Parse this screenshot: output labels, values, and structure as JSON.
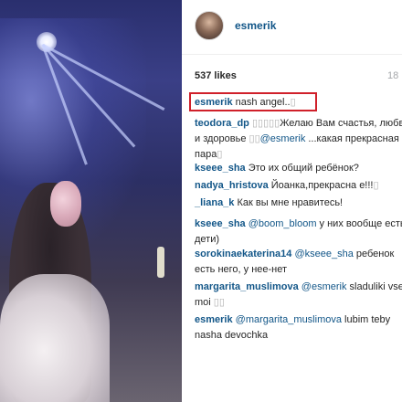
{
  "post": {
    "username": "esmerik",
    "likes": "537 likes",
    "time": "18"
  },
  "comments": [
    {
      "user": "esmerik",
      "parts": [
        {
          "t": "text",
          "v": " nash angel.."
        },
        {
          "t": "emoji",
          "v": "▯"
        }
      ]
    },
    {
      "user": "teodora_dp",
      "parts": [
        {
          "t": "text",
          "v": " "
        },
        {
          "t": "emoji",
          "v": "▯▯▯▯▯"
        },
        {
          "t": "text",
          "v": "Желаю Вам счастья, любви и здоровье "
        },
        {
          "t": "emoji",
          "v": "▯▯"
        },
        {
          "t": "mention",
          "v": "@esmerik"
        },
        {
          "t": "text",
          "v": " ...какая прекрасная пара"
        },
        {
          "t": "emoji",
          "v": "▯"
        }
      ]
    },
    {
      "user": "kseee_sha",
      "parts": [
        {
          "t": "text",
          "v": " Это их общий ребёнок?"
        }
      ]
    },
    {
      "user": "nadya_hristova",
      "parts": [
        {
          "t": "text",
          "v": " Йоанка,прекрасна е!!!"
        },
        {
          "t": "emoji",
          "v": "▯"
        }
      ]
    },
    {
      "user": "_liana_k",
      "parts": [
        {
          "t": "text",
          "v": " Как вы мне нравитесь!"
        }
      ]
    },
    {
      "user": "kseee_sha",
      "parts": [
        {
          "t": "text",
          "v": " "
        },
        {
          "t": "mention",
          "v": "@boom_bloom"
        },
        {
          "t": "text",
          "v": " у них вообще есть дети)"
        }
      ]
    },
    {
      "user": "sorokinaekaterina14",
      "parts": [
        {
          "t": "text",
          "v": " "
        },
        {
          "t": "mention",
          "v": "@kseee_sha"
        },
        {
          "t": "text",
          "v": " ребенок есть него, у нее-нет"
        }
      ]
    },
    {
      "user": "margarita_muslimova",
      "parts": [
        {
          "t": "text",
          "v": " "
        },
        {
          "t": "mention",
          "v": "@esmerik"
        },
        {
          "t": "text",
          "v": " sladuliki vse moi "
        },
        {
          "t": "emoji",
          "v": "▯▯"
        }
      ]
    },
    {
      "user": "esmerik",
      "parts": [
        {
          "t": "text",
          "v": " "
        },
        {
          "t": "mention",
          "v": "@margarita_muslimova"
        },
        {
          "t": "text",
          "v": " lubim teby nasha devochka"
        }
      ]
    }
  ]
}
